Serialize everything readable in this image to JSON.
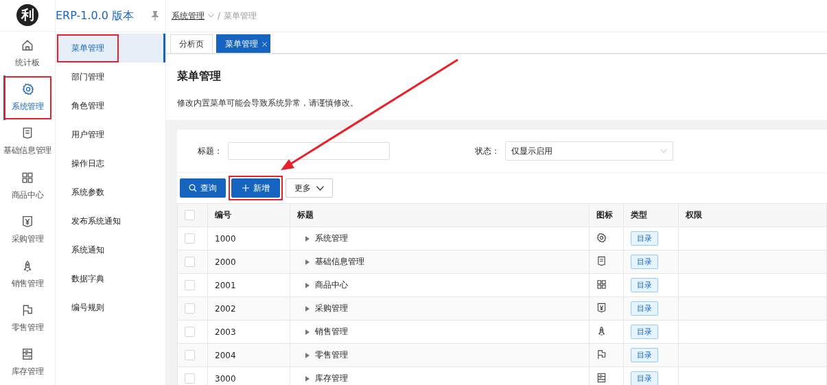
{
  "app": {
    "logo": "利",
    "title": "ERP-1.0.0 版本"
  },
  "breadcrumb": [
    {
      "label": "系统管理",
      "kind": "dropdown"
    },
    {
      "label": "/",
      "kind": "separator"
    },
    {
      "label": "菜单管理",
      "kind": "current"
    }
  ],
  "rail": [
    {
      "label": "统计板",
      "selected": false,
      "outlined": false
    },
    {
      "label": "系统管理",
      "selected": true,
      "outlined": true
    },
    {
      "label": "基础信息管理",
      "selected": false,
      "outlined": false
    },
    {
      "label": "商品中心",
      "selected": false,
      "outlined": false
    },
    {
      "label": "采购管理",
      "selected": false,
      "outlined": false
    },
    {
      "label": "销售管理",
      "selected": false,
      "outlined": false
    },
    {
      "label": "零售管理",
      "selected": false,
      "outlined": false
    },
    {
      "label": "库存管理",
      "selected": false,
      "outlined": false
    }
  ],
  "submenu": [
    {
      "label": "菜单管理",
      "selected": true,
      "outlined": true
    },
    {
      "label": "部门管理",
      "selected": false,
      "outlined": false
    },
    {
      "label": "角色管理",
      "selected": false,
      "outlined": false
    },
    {
      "label": "用户管理",
      "selected": false,
      "outlined": false
    },
    {
      "label": "操作日志",
      "selected": false,
      "outlined": false
    },
    {
      "label": "系统参数",
      "selected": false,
      "outlined": false
    },
    {
      "label": "发布系统通知",
      "selected": false,
      "outlined": false
    },
    {
      "label": "系统通知",
      "selected": false,
      "outlined": false
    },
    {
      "label": "数据字典",
      "selected": false,
      "outlined": false
    },
    {
      "label": "编号规则",
      "selected": false,
      "outlined": false
    }
  ],
  "tabs": [
    {
      "label": "分析页",
      "selected": false,
      "closable": false
    },
    {
      "label": "菜单管理",
      "selected": true,
      "closable": true
    }
  ],
  "page": {
    "title": "菜单管理",
    "notice": "修改内置菜单可能会导致系统异常，请谨慎修改。"
  },
  "filters": [
    {
      "kind": "input",
      "label": "标题："
    },
    {
      "kind": "select",
      "label": "状态：",
      "value": "仅显示启用"
    }
  ],
  "buttons": [
    {
      "kind": "search",
      "label": "查询",
      "outlined": false
    },
    {
      "kind": "add",
      "label": "新增",
      "outlined": true
    },
    {
      "kind": "more",
      "label": "更多",
      "outlined": false
    }
  ],
  "pointer_arrow": true,
  "table": {
    "select_all": {
      "checked": false
    },
    "columns": [
      "编号",
      "标题",
      "图标",
      "类型",
      "权限"
    ],
    "rows": [
      {
        "checked": false,
        "id": "1000",
        "title": "系统管理",
        "expanded": false,
        "type": "目录"
      },
      {
        "checked": false,
        "id": "2000",
        "title": "基础信息管理",
        "expanded": false,
        "type": "目录"
      },
      {
        "checked": false,
        "id": "2001",
        "title": "商品中心",
        "expanded": false,
        "type": "目录"
      },
      {
        "checked": false,
        "id": "2002",
        "title": "采购管理",
        "expanded": false,
        "type": "目录"
      },
      {
        "checked": false,
        "id": "2003",
        "title": "销售管理",
        "expanded": false,
        "type": "目录"
      },
      {
        "checked": false,
        "id": "2004",
        "title": "零售管理",
        "expanded": false,
        "type": "目录"
      },
      {
        "checked": false,
        "id": "3000",
        "title": "库存管理",
        "expanded": false,
        "type": "目录"
      }
    ]
  }
}
